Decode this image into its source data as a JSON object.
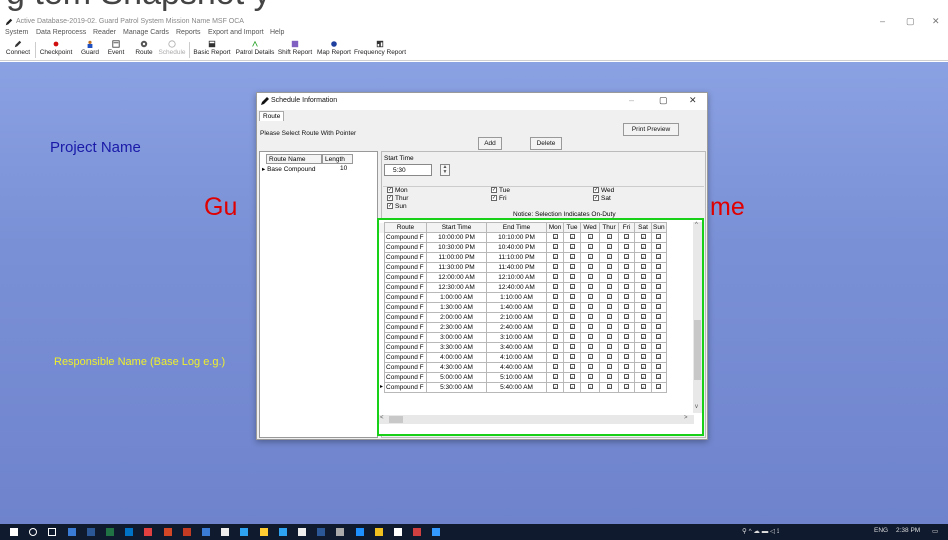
{
  "slide_header": {
    "partial_title": "g    tem Snapshot   y"
  },
  "window": {
    "title": "Active Database-2019-02. Guard Patrol System Mission Name  MSF OCA",
    "controls": [
      "–",
      "▢",
      "✕"
    ]
  },
  "menu": [
    "System",
    "Data Reprocess",
    "Reader",
    "Manage Cards",
    "Reports",
    "Export and Import",
    "Help"
  ],
  "toolbar": {
    "items": [
      {
        "label": "Connect",
        "icon": "pencil-icon",
        "color": "#333333"
      },
      {
        "label": "Checkpoint",
        "icon": "checkpoint-icon",
        "color": "#d01010"
      },
      {
        "label": "Guard",
        "icon": "guard-icon",
        "color": "#c07020"
      },
      {
        "label": "Event",
        "icon": "event-icon",
        "color": "#333333"
      },
      {
        "label": "Route",
        "icon": "route-icon",
        "color": "#333333"
      },
      {
        "label": "Schedule",
        "icon": "schedule-icon",
        "color": "#aaaaaa"
      },
      {
        "label": "Basic Report",
        "icon": "basic-report-icon",
        "color": "#333333"
      },
      {
        "label": "Patrol Details",
        "icon": "patrol-details-icon",
        "color": "#20a020"
      },
      {
        "label": "Shift Report",
        "icon": "shift-report-icon",
        "color": "#8060c0"
      },
      {
        "label": "Map Report",
        "icon": "map-report-icon",
        "color": "#2040a0"
      },
      {
        "label": "Frequency Report",
        "icon": "frequency-report-icon",
        "color": "#333333"
      }
    ]
  },
  "background": {
    "project_name": "Project Name",
    "responsible_name": "Responsible Name (Base Log e.g.)",
    "red_left": "Gu",
    "red_right": "me"
  },
  "dialog": {
    "title": "Schedule Information",
    "tab": "Route",
    "hint": "Please Select Route With Pointer",
    "buttons": {
      "add": "Add",
      "delete": "Delete",
      "print_preview": "Print Preview"
    },
    "route_list": {
      "headers": [
        "Route Name",
        "Length"
      ],
      "rows": [
        {
          "name": "Base Compound",
          "length": "10"
        }
      ]
    },
    "start_time_label": "Start Time",
    "start_time_value": "5:30",
    "days": [
      "Mon",
      "Tue",
      "Wed",
      "Thur",
      "Fri",
      "Sat",
      "Sun"
    ],
    "notice": "Notice: Selection Indicates On-Duty",
    "grid": {
      "headers": [
        "Route",
        "Start Time",
        "End Time",
        "Mon",
        "Tue",
        "Wed",
        "Thur",
        "Fri",
        "Sat",
        "Sun"
      ],
      "rows": [
        [
          "Compound F",
          "10:00:00 PM",
          "10:10:00 PM"
        ],
        [
          "Compound F",
          "10:30:00 PM",
          "10:40:00 PM"
        ],
        [
          "Compound F",
          "11:00:00 PM",
          "11:10:00 PM"
        ],
        [
          "Compound F",
          "11:30:00 PM",
          "11:40:00 PM"
        ],
        [
          "Compound F",
          "12:00:00 AM",
          "12:10:00 AM"
        ],
        [
          "Compound F",
          "12:30:00 AM",
          "12:40:00 AM"
        ],
        [
          "Compound F",
          "1:00:00 AM",
          "1:10:00 AM"
        ],
        [
          "Compound F",
          "1:30:00 AM",
          "1:40:00 AM"
        ],
        [
          "Compound F",
          "2:00:00 AM",
          "2:10:00 AM"
        ],
        [
          "Compound F",
          "2:30:00 AM",
          "2:40:00 AM"
        ],
        [
          "Compound F",
          "3:00:00 AM",
          "3:10:00 AM"
        ],
        [
          "Compound F",
          "3:30:00 AM",
          "3:40:00 AM"
        ],
        [
          "Compound F",
          "4:00:00 AM",
          "4:10:00 AM"
        ],
        [
          "Compound F",
          "4:30:00 AM",
          "4:40:00 AM"
        ],
        [
          "Compound F",
          "5:00:00 AM",
          "5:10:00 AM"
        ],
        [
          "Compound F",
          "5:30:00 AM",
          "5:40:00 AM"
        ]
      ],
      "selected_row_index": 15
    }
  },
  "taskbar": {
    "icons": [
      "windows-start-icon",
      "search-icon",
      "task-view-icon",
      "file-explorer-icon",
      "word-icon",
      "excel-icon",
      "outlook-icon",
      "app-icon",
      "powerpoint-icon",
      "app-icon",
      "app-icon",
      "app-icon",
      "app-icon",
      "app-icon",
      "app-icon",
      "app-icon",
      "app-icon",
      "app-icon",
      "ie-icon",
      "app-icon",
      "pen-app-icon",
      "app-icon",
      "app-icon"
    ],
    "tray_language": "ENG",
    "tray_time": "2:38 PM"
  }
}
